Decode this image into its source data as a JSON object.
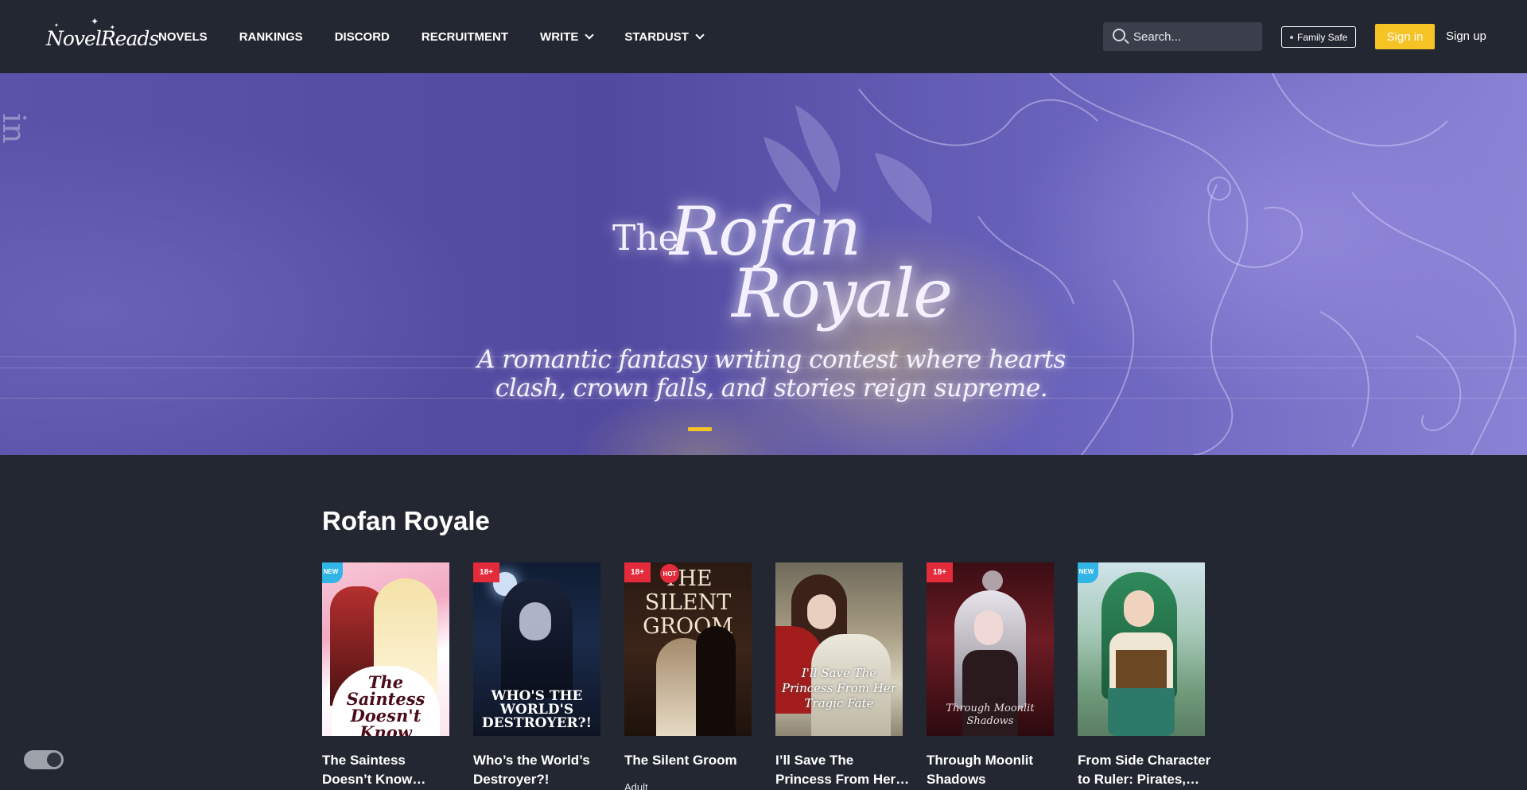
{
  "header": {
    "logo_text": "NovelReads",
    "nav": [
      {
        "label": "NOVELS",
        "dropdown": false
      },
      {
        "label": "RANKINGS",
        "dropdown": false
      },
      {
        "label": "DISCORD",
        "dropdown": false
      },
      {
        "label": "RECRUITMENT",
        "dropdown": false
      },
      {
        "label": "WRITE",
        "dropdown": true
      },
      {
        "label": "STARDUST",
        "dropdown": true
      }
    ],
    "search": {
      "placeholder": "Search...",
      "value": ""
    },
    "family_safe_label": "Family Safe",
    "sign_in_label": "Sign in",
    "sign_up_label": "Sign up"
  },
  "banner": {
    "title_the": "The",
    "title_rofan": "Rofan",
    "title_royale": "Royale",
    "subtitle_line1": "A romantic fantasy writing contest where hearts",
    "subtitle_line2": "clash, crown falls, and stories reign supreme.",
    "slide_active": 1
  },
  "section": {
    "title": "Rofan Royale",
    "books": [
      {
        "title_line1": "The Saintess",
        "title_line2": "Doesn’t Know…",
        "cover_text": "The Saintess Doesn't Know Anything",
        "badges": [
          "NEW"
        ],
        "meta": ""
      },
      {
        "title_line1": "Who’s the World’s",
        "title_line2": "Destroyer?!",
        "cover_text": "WHO'S THE WORLD'S DESTROYER?!",
        "badges": [
          "18+"
        ],
        "meta": ""
      },
      {
        "title_line1": "The Silent Groom",
        "title_line2": "",
        "cover_text": "THE SILENT GROOM",
        "badges": [
          "18+",
          "HOT"
        ],
        "meta": "Adult"
      },
      {
        "title_line1": "I’ll Save The",
        "title_line2": "Princess From Her…",
        "cover_text": "I'll Save The Princess From Her Tragic Fate",
        "badges": [],
        "meta": ""
      },
      {
        "title_line1": "Through Moonlit",
        "title_line2": "Shadows",
        "cover_text": "Through Moonlit Shadows",
        "badges": [
          "18+"
        ],
        "meta": ""
      },
      {
        "title_line1": "From Side Character",
        "title_line2": "to Ruler: Pirates,…",
        "cover_text": "",
        "badges": [
          "NEW"
        ],
        "meta": ""
      }
    ]
  },
  "theme_toggle": {
    "state": "dark"
  }
}
